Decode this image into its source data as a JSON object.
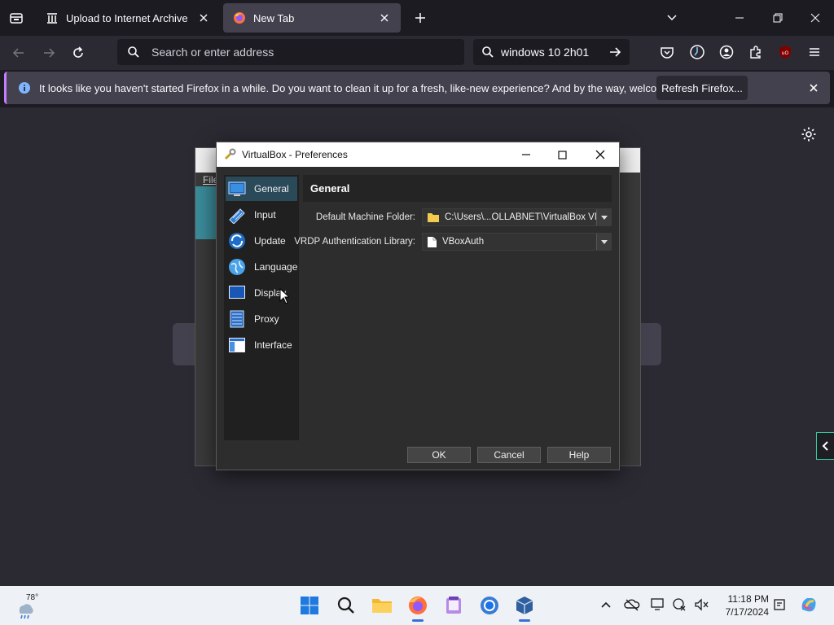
{
  "browser": {
    "tabs": [
      {
        "title": "Upload to Internet Archive",
        "favicon": "archive-icon"
      },
      {
        "title": "New Tab",
        "favicon": "firefox-icon",
        "active": true
      }
    ],
    "address_placeholder": "Search or enter address",
    "search_value": "windows 10 2h01",
    "notification": {
      "message": "It looks like you haven't started Firefox in a while. Do you want to clean it up for a fresh, like-new experience? And by the way, welcome back!",
      "button_label": "Refresh Firefox..."
    }
  },
  "bg_window": {
    "menu_label": "File"
  },
  "dialog": {
    "title": "VirtualBox - Preferences",
    "categories": [
      {
        "label": "General",
        "icon": "monitor-icon",
        "selected": true
      },
      {
        "label": "Input",
        "icon": "keyboard-icon"
      },
      {
        "label": "Update",
        "icon": "refresh-globe-icon"
      },
      {
        "label": "Language",
        "icon": "globe-icon"
      },
      {
        "label": "Display",
        "icon": "display-icon"
      },
      {
        "label": "Proxy",
        "icon": "proxy-server-icon"
      },
      {
        "label": "Interface",
        "icon": "window-layout-icon"
      }
    ],
    "panel_title": "General",
    "fields": [
      {
        "label": "Default Machine Folder:",
        "value": "C:\\Users\\...OLLABNET\\VirtualBox VMs",
        "icon": "folder-icon"
      },
      {
        "label": "VRDP Authentication Library:",
        "value": "VBoxAuth",
        "icon": "file-icon"
      }
    ],
    "buttons": {
      "ok": "OK",
      "cancel": "Cancel",
      "help": "Help"
    }
  },
  "taskbar": {
    "weather_temp": "78°",
    "time": "11:18 PM",
    "date": "7/17/2024"
  },
  "colors": {
    "firefox_dark": "#1c1b22",
    "toolbar": "#2b2a33",
    "selection": "#2a4a5a",
    "taskbar": "#eef1f6"
  }
}
